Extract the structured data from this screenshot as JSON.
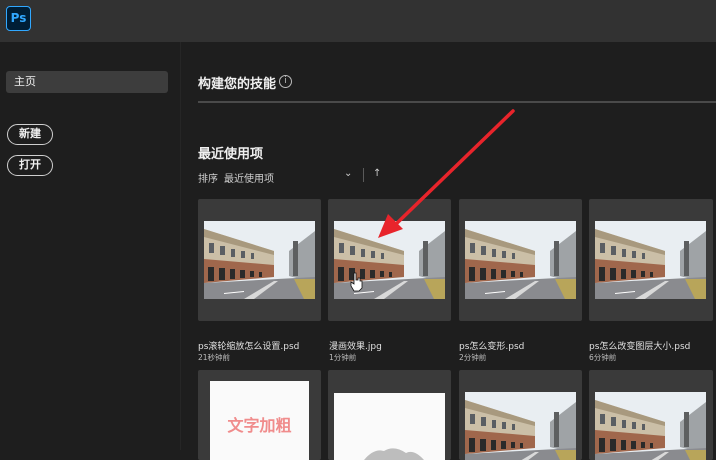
{
  "app": {
    "logo_text": "Ps",
    "accent": "#31a8ff"
  },
  "sidebar": {
    "home_label": "主页",
    "new_label": "新建",
    "open_label": "打开"
  },
  "main": {
    "skills_title": "构建您的技能",
    "info_icon": "info-icon",
    "recent_title": "最近使用项",
    "sort_label": "排序",
    "sort_value": "最近使用项"
  },
  "recent_files": [
    {
      "name": "ps滚轮缩放怎么设置.psd",
      "time": "21秒钟前"
    },
    {
      "name": "漫画效果.jpg",
      "time": "1分钟前"
    },
    {
      "name": "ps怎么变形.psd",
      "time": "2分钟前"
    },
    {
      "name": "ps怎么改变图层大小.psd",
      "time": "6分钟前"
    }
  ],
  "second_row": {
    "text_thumb_label": "文字加粗"
  },
  "annotation_color": "#e8242b"
}
